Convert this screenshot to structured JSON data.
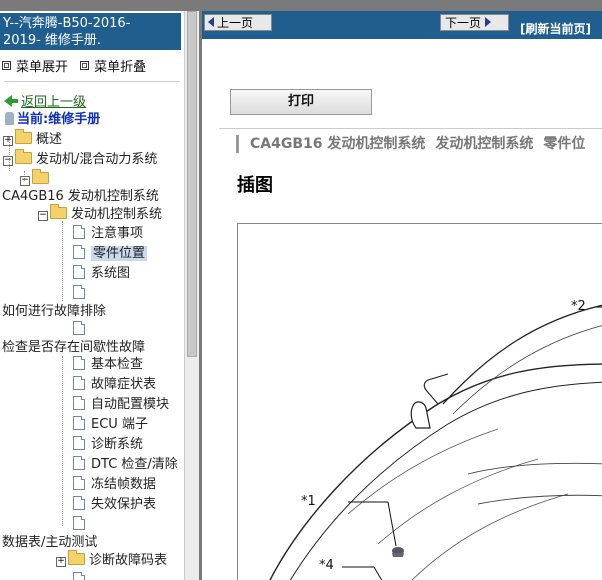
{
  "left": {
    "title_line1": "Y--汽奔腾-B50-2016-",
    "title_line2": "2019- 维修手册.",
    "menu_expand": "菜单展开",
    "menu_collapse": "菜单折叠",
    "back": "返回上一级",
    "current": "当前:维修手册",
    "tree": {
      "overview": "概述",
      "engine_hybrid": "发动机/混合动力系统",
      "ca4gb16": "CA4GB16 发动机控制系统",
      "engine_ctrl": "发动机控制系统",
      "notes": "注意事项",
      "part_location": "零件位置",
      "system_diagram": "系统图",
      "troubleshoot": "如何进行故障排除",
      "intermittent": "检查是否存在间歇性故障",
      "basic_check": "基本检查",
      "symptom_table": "故障症状表",
      "auto_config": "自动配置模块",
      "ecu_terminal": "ECU 端子",
      "diag_system": "诊断系统",
      "dtc_check": "DTC 检查/清除",
      "freeze_frame": "冻结帧数据",
      "failsafe": "失效保护表",
      "data_list": "数据表/主动测试",
      "dtc_table": "诊断故障码表"
    }
  },
  "right": {
    "prev": "上一页",
    "next": "下一页",
    "refresh": "[刷新当前页]",
    "print": "打印",
    "crumbs": [
      "CA4GB16 发动机控制系统",
      "发动机控制系统",
      "零件位"
    ],
    "heading": "插图",
    "figure": {
      "callout1": "*1",
      "callout2": "*2",
      "callout4": "*4"
    }
  },
  "colors": {
    "title_bg": "#1f5e8f",
    "nav_bg": "#1f5e8f",
    "selected_bg": "#c9d9ef",
    "back_link": "#1c6a1c",
    "current_link": "#1030c0"
  }
}
